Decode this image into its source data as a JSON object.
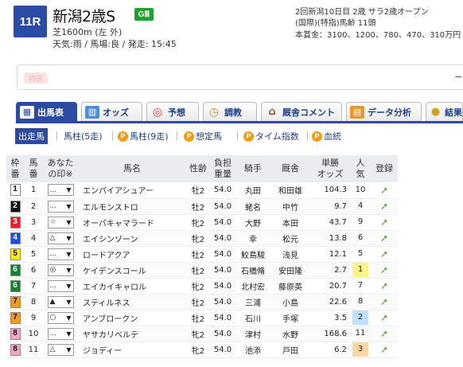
{
  "race": {
    "number": "11R",
    "name": "新潟2歳S",
    "grade": "GⅢ",
    "course": "芝1600m (左 外)",
    "conditions": "天気:雨 / 馬場:良 / 発走: 15:45",
    "meeting": "2回新潟10日目 2歳 サラ2歳オープン",
    "category": "(国際)(特指)馬齢 11頭",
    "prize": "本賞金：3100、1200、780、470、310万円"
  },
  "ad": {
    "pill": "特選",
    "dash": "–"
  },
  "tabs": [
    {
      "label": "出馬表",
      "icon": "table-icon"
    },
    {
      "label": "オッズ",
      "icon": "chart-icon"
    },
    {
      "label": "予想",
      "icon": "target-icon"
    },
    {
      "label": "調教",
      "icon": "stopwatch-icon"
    },
    {
      "label": "厩舎コメント",
      "icon": "stable-icon"
    },
    {
      "label": "データ分析",
      "icon": "graph-icon"
    },
    {
      "label": "結果",
      "icon": "coins-icon"
    }
  ],
  "subnav": [
    {
      "label": "出走馬",
      "premium": false
    },
    {
      "label": "馬柱(5走)",
      "premium": false
    },
    {
      "label": "馬柱(9走)",
      "premium": true
    },
    {
      "label": "想定馬",
      "premium": true
    },
    {
      "label": "タイム指数",
      "premium": true
    },
    {
      "label": "血統",
      "premium": true
    }
  ],
  "table": {
    "headers": {
      "waku": "枠\n番",
      "umaban": "馬\n番",
      "mark": "あなた\nの印※",
      "name": "馬名",
      "sexage": "性齢",
      "weight": "負担\n重量",
      "jockey": "騎手",
      "trainer": "厩舎",
      "odds": "単勝\nオッズ",
      "pop": "人\n気",
      "reg": "登録"
    },
    "rows": [
      {
        "waku": "1",
        "umaban": "1",
        "mark": "...",
        "name": "エンパイアシュアー",
        "sexage": "牡2",
        "weight": "54.0",
        "jockey": "丸田",
        "trainer": "和田雄",
        "odds": "104.3",
        "pop": "10"
      },
      {
        "waku": "2",
        "umaban": "2",
        "mark": "...",
        "name": "エルモンストロ",
        "sexage": "牡2",
        "weight": "54.0",
        "jockey": "蛯名",
        "trainer": "中竹",
        "odds": "9.7",
        "pop": "4"
      },
      {
        "waku": "3",
        "umaban": "3",
        "mark": "☆",
        "name": "オーパキャマラード",
        "sexage": "牝2",
        "weight": "54.0",
        "jockey": "大野",
        "trainer": "本田",
        "odds": "43.7",
        "pop": "9"
      },
      {
        "waku": "4",
        "umaban": "4",
        "mark": "△",
        "name": "エイシンゾーン",
        "sexage": "牝2",
        "weight": "54.0",
        "jockey": "幸",
        "trainer": "松元",
        "odds": "13.8",
        "pop": "6"
      },
      {
        "waku": "5",
        "umaban": "5",
        "mark": "...",
        "name": "ロードアクア",
        "sexage": "牡2",
        "weight": "54.0",
        "jockey": "鮫島駿",
        "trainer": "浅見",
        "odds": "12.1",
        "pop": "5"
      },
      {
        "waku": "6",
        "umaban": "6",
        "mark": "◎",
        "name": "ケイデンスコール",
        "sexage": "牡2",
        "weight": "54.0",
        "jockey": "石橋脩",
        "trainer": "安田隆",
        "odds": "2.7",
        "pop": "1"
      },
      {
        "waku": "6",
        "umaban": "7",
        "mark": "...",
        "name": "エイカイキャロル",
        "sexage": "牝2",
        "weight": "54.0",
        "jockey": "北村宏",
        "trainer": "藤原英",
        "odds": "20.7",
        "pop": "7"
      },
      {
        "waku": "7",
        "umaban": "8",
        "mark": "▲",
        "name": "スティルネス",
        "sexage": "牡2",
        "weight": "54.0",
        "jockey": "三浦",
        "trainer": "小島",
        "odds": "22.6",
        "pop": "8"
      },
      {
        "waku": "7",
        "umaban": "9",
        "mark": "○",
        "name": "アンブロークン",
        "sexage": "牡2",
        "weight": "54.0",
        "jockey": "石川",
        "trainer": "手塚",
        "odds": "3.5",
        "pop": "2"
      },
      {
        "waku": "8",
        "umaban": "10",
        "mark": "...",
        "name": "ヤサカリベルテ",
        "sexage": "牝2",
        "weight": "54.0",
        "jockey": "津村",
        "trainer": "水野",
        "odds": "168.6",
        "pop": "11"
      },
      {
        "waku": "8",
        "umaban": "11",
        "mark": "△",
        "name": "ジョディー",
        "sexage": "牝2",
        "weight": "54.0",
        "jockey": "池添",
        "trainer": "戸田",
        "odds": "6.2",
        "pop": "3"
      }
    ]
  },
  "waku_colors": {
    "1": {
      "bg": "#ffffff",
      "fg": "#111111"
    },
    "2": {
      "bg": "#111111",
      "fg": "#ffffff"
    },
    "3": {
      "bg": "#e8202b",
      "fg": "#ffffff"
    },
    "4": {
      "bg": "#1f4fd6",
      "fg": "#ffffff"
    },
    "5": {
      "bg": "#ffe81a",
      "fg": "#111111"
    },
    "6": {
      "bg": "#13822f",
      "fg": "#ffffff"
    },
    "7": {
      "bg": "#f39a1e",
      "fg": "#111111"
    },
    "8": {
      "bg": "#f6a6c0",
      "fg": "#111111"
    }
  }
}
